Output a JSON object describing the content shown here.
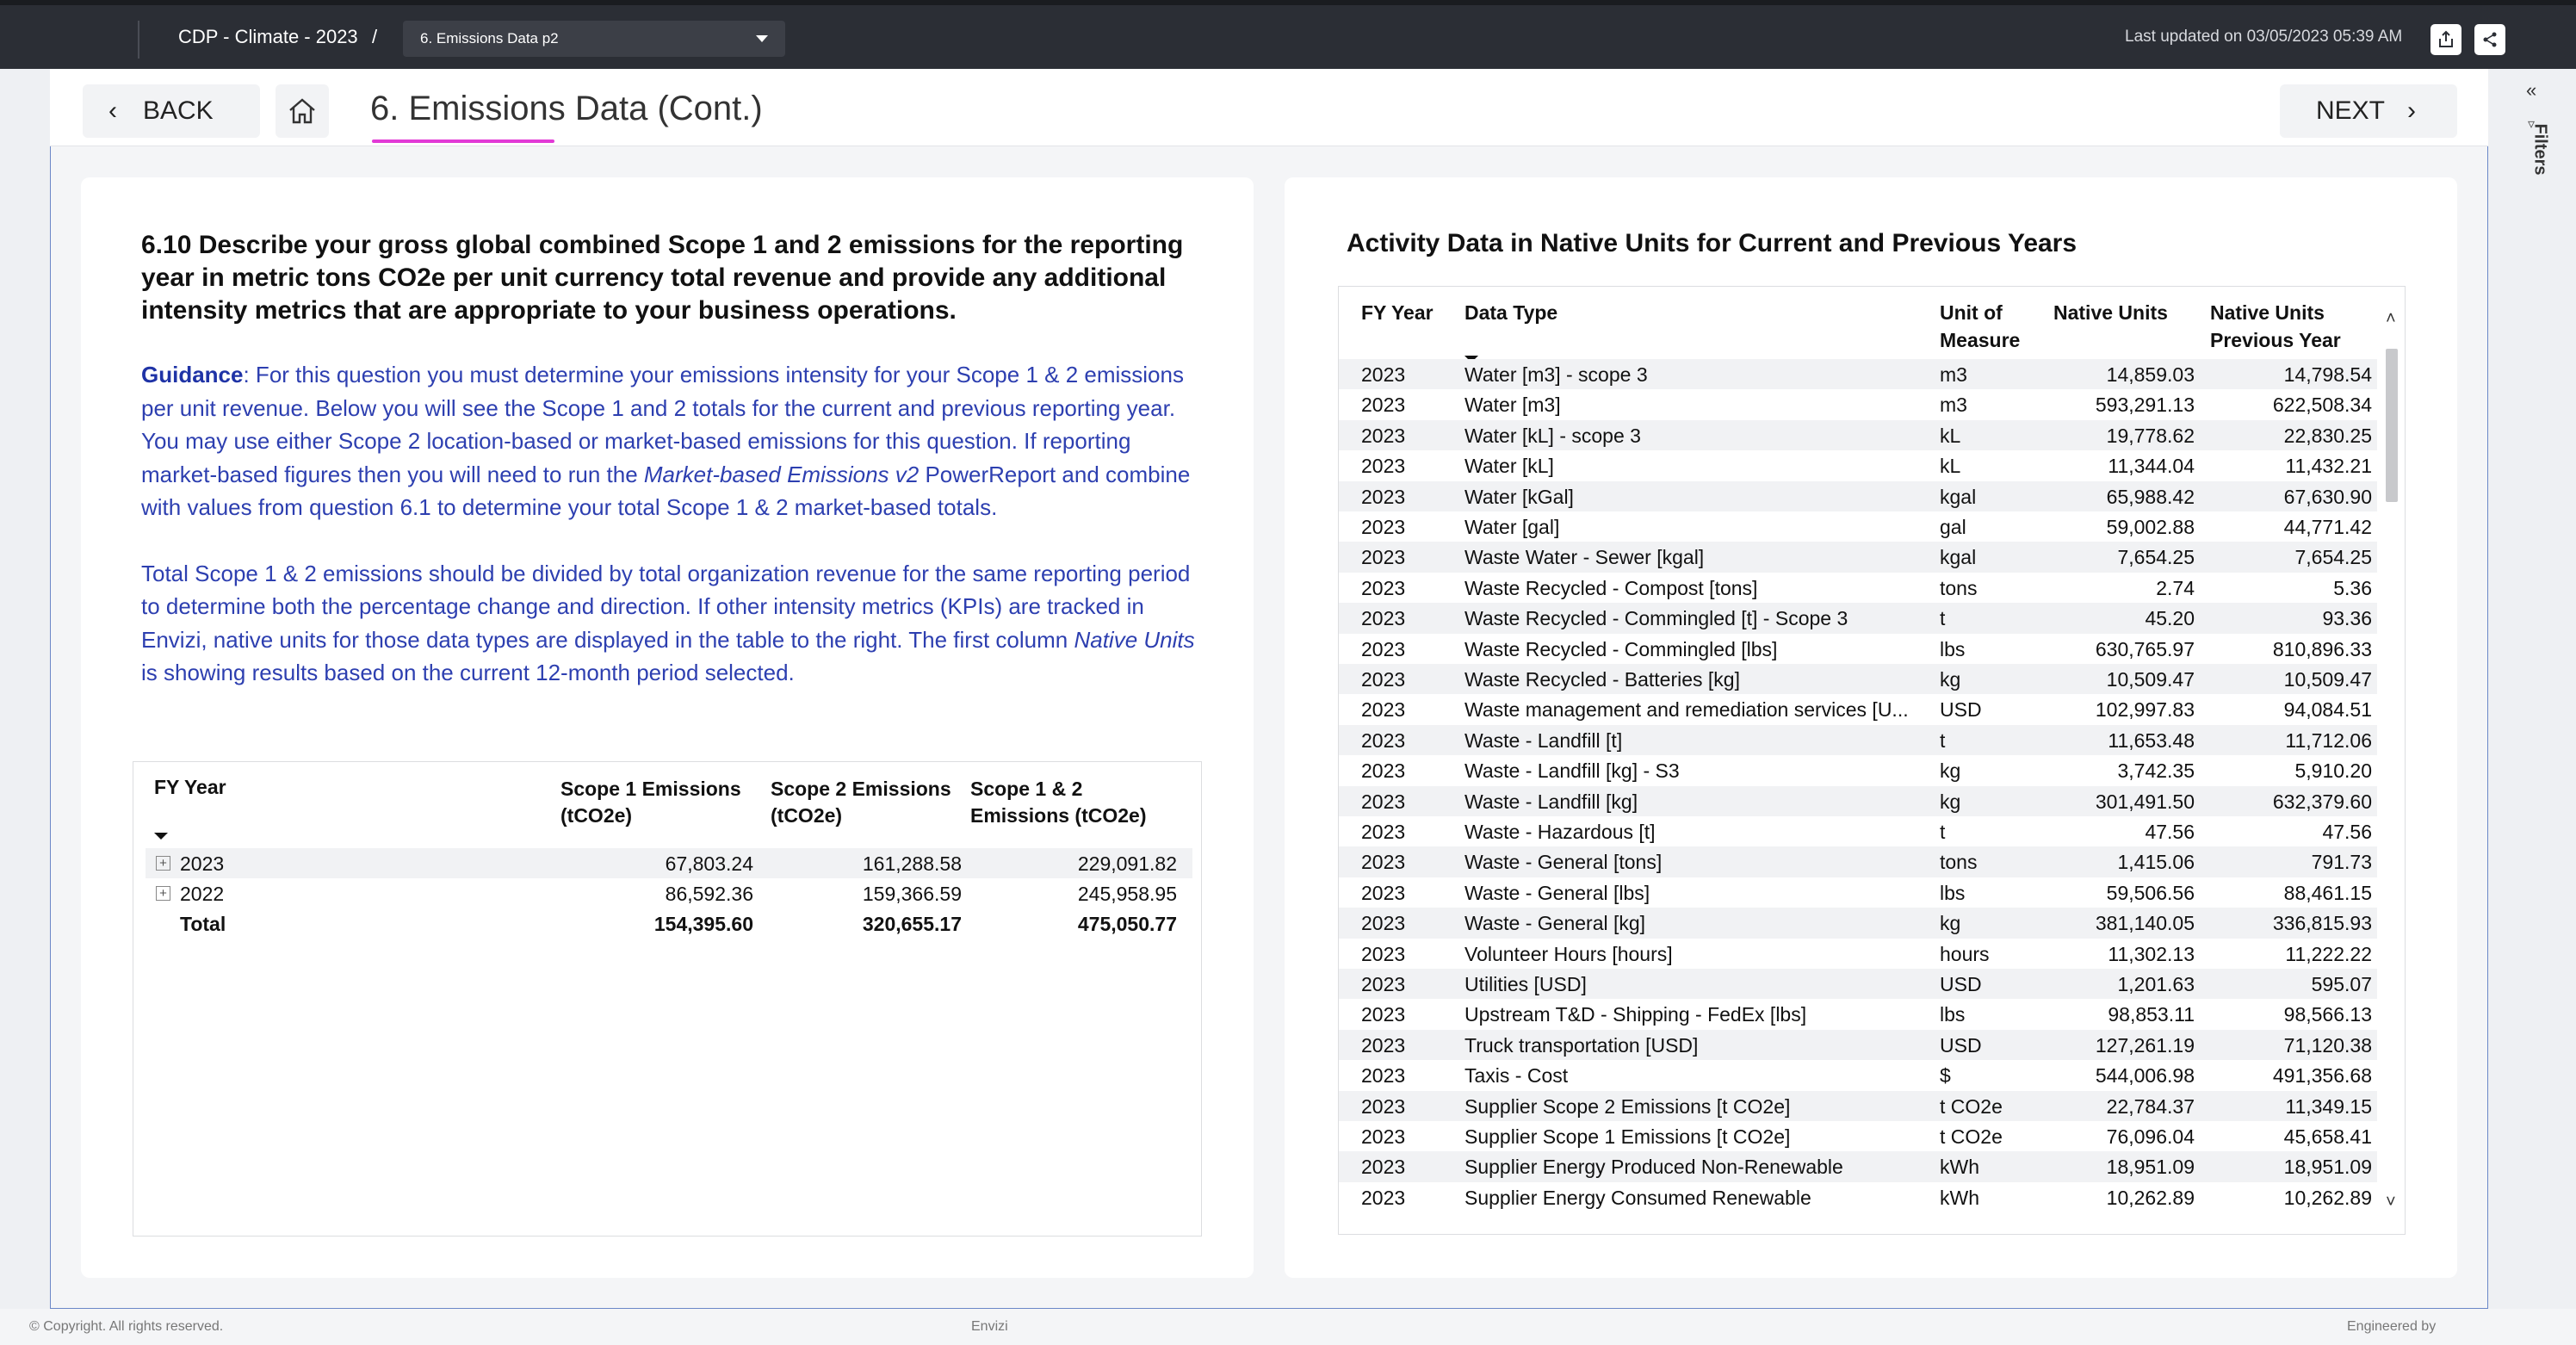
{
  "topbar": {
    "breadcrumb": "CDP - Climate - 2023",
    "separator": "/",
    "page_select": "6. Emissions Data p2",
    "last_updated": "Last updated on 03/05/2023 05:39 AM"
  },
  "filters_label": "Filters",
  "nav": {
    "back_label": "BACK",
    "next_label": "NEXT",
    "page_title": "6. Emissions Data (Cont.)"
  },
  "left": {
    "question": "6.10 Describe your gross global combined Scope 1 and 2 emissions for the reporting year in metric tons CO2e per unit currency total revenue and provide any additional intensity metrics that are appropriate to your business operations.",
    "guidance_label": "Guidance",
    "guidance_p1a": ": For this question you must determine your emissions intensity for your Scope 1 & 2 emissions per unit revenue. Below you will see the Scope 1 and 2 totals for the current and previous reporting year. You may use either Scope 2 location-based or market-based emissions for this question. If reporting market-based figures then you will need to run the ",
    "guidance_p1_em": "Market-based Emissions v2",
    "guidance_p1b": " PowerReport and combine with values from question 6.1 to determine your total Scope 1 & 2 market-based totals.",
    "guidance_p2a": "Total Scope 1 & 2 emissions should be divided by total organization revenue for the same reporting period to determine both the percentage change and direction. If other intensity metrics (KPIs) are tracked in Envizi, native units for those data types are displayed in the table to the right. The first column ",
    "guidance_p2_em": "Native Units",
    "guidance_p2b": " is showing results based on the current 12-month period selected.",
    "table": {
      "headers": {
        "year": "FY Year",
        "s1": "Scope 1 Emissions (tCO2e)",
        "s2": "Scope 2 Emissions (tCO2e)",
        "s12": "Scope 1 & 2 Emissions (tCO2e)"
      },
      "rows": [
        {
          "year": "2023",
          "s1": "67,803.24",
          "s2": "161,288.58",
          "s12": "229,091.82"
        },
        {
          "year": "2022",
          "s1": "86,592.36",
          "s2": "159,366.59",
          "s12": "245,958.95"
        }
      ],
      "total": {
        "year": "Total",
        "s1": "154,395.60",
        "s2": "320,655.17",
        "s12": "475,050.77"
      }
    }
  },
  "right": {
    "title": "Activity Data in Native Units for Current and Previous Years",
    "headers": {
      "year": "FY Year",
      "type": "Data Type",
      "unit": "Unit of Measure",
      "native": "Native Units",
      "prev": "Native Units Previous Year"
    },
    "rows": [
      {
        "year": "2023",
        "type": "Water [m3] - scope 3",
        "unit": "m3",
        "native": "14,859.03",
        "prev": "14,798.54"
      },
      {
        "year": "2023",
        "type": "Water [m3]",
        "unit": "m3",
        "native": "593,291.13",
        "prev": "622,508.34"
      },
      {
        "year": "2023",
        "type": "Water [kL] - scope 3",
        "unit": "kL",
        "native": "19,778.62",
        "prev": "22,830.25"
      },
      {
        "year": "2023",
        "type": "Water [kL]",
        "unit": "kL",
        "native": "11,344.04",
        "prev": "11,432.21"
      },
      {
        "year": "2023",
        "type": "Water [kGal]",
        "unit": "kgal",
        "native": "65,988.42",
        "prev": "67,630.90"
      },
      {
        "year": "2023",
        "type": "Water [gal]",
        "unit": "gal",
        "native": "59,002.88",
        "prev": "44,771.42"
      },
      {
        "year": "2023",
        "type": "Waste Water - Sewer [kgal]",
        "unit": "kgal",
        "native": "7,654.25",
        "prev": "7,654.25"
      },
      {
        "year": "2023",
        "type": "Waste Recycled - Compost [tons]",
        "unit": "tons",
        "native": "2.74",
        "prev": "5.36"
      },
      {
        "year": "2023",
        "type": "Waste Recycled - Commingled [t] - Scope 3",
        "unit": "t",
        "native": "45.20",
        "prev": "93.36"
      },
      {
        "year": "2023",
        "type": "Waste Recycled - Commingled [lbs]",
        "unit": "lbs",
        "native": "630,765.97",
        "prev": "810,896.33"
      },
      {
        "year": "2023",
        "type": "Waste Recycled - Batteries [kg]",
        "unit": "kg",
        "native": "10,509.47",
        "prev": "10,509.47"
      },
      {
        "year": "2023",
        "type": "Waste management and remediation services [U...",
        "unit": "USD",
        "native": "102,997.83",
        "prev": "94,084.51"
      },
      {
        "year": "2023",
        "type": "Waste - Landfill [t]",
        "unit": "t",
        "native": "11,653.48",
        "prev": "11,712.06"
      },
      {
        "year": "2023",
        "type": "Waste - Landfill [kg] - S3",
        "unit": "kg",
        "native": "3,742.35",
        "prev": "5,910.20"
      },
      {
        "year": "2023",
        "type": "Waste - Landfill [kg]",
        "unit": "kg",
        "native": "301,491.50",
        "prev": "632,379.60"
      },
      {
        "year": "2023",
        "type": "Waste - Hazardous [t]",
        "unit": "t",
        "native": "47.56",
        "prev": "47.56"
      },
      {
        "year": "2023",
        "type": "Waste - General [tons]",
        "unit": "tons",
        "native": "1,415.06",
        "prev": "791.73"
      },
      {
        "year": "2023",
        "type": "Waste - General [lbs]",
        "unit": "lbs",
        "native": "59,506.56",
        "prev": "88,461.15"
      },
      {
        "year": "2023",
        "type": "Waste - General [kg]",
        "unit": "kg",
        "native": "381,140.05",
        "prev": "336,815.93"
      },
      {
        "year": "2023",
        "type": "Volunteer Hours [hours]",
        "unit": "hours",
        "native": "11,302.13",
        "prev": "11,222.22"
      },
      {
        "year": "2023",
        "type": "Utilities [USD]",
        "unit": "USD",
        "native": "1,201.63",
        "prev": "595.07"
      },
      {
        "year": "2023",
        "type": "Upstream T&D - Shipping - FedEx [lbs]",
        "unit": "lbs",
        "native": "98,853.11",
        "prev": "98,566.13"
      },
      {
        "year": "2023",
        "type": "Truck transportation [USD]",
        "unit": "USD",
        "native": "127,261.19",
        "prev": "71,120.38"
      },
      {
        "year": "2023",
        "type": "Taxis - Cost",
        "unit": "$",
        "native": "544,006.98",
        "prev": "491,356.68"
      },
      {
        "year": "2023",
        "type": "Supplier Scope 2 Emissions [t CO2e]",
        "unit": "t CO2e",
        "native": "22,784.37",
        "prev": "11,349.15"
      },
      {
        "year": "2023",
        "type": "Supplier Scope 1 Emissions [t CO2e]",
        "unit": "t CO2e",
        "native": "76,096.04",
        "prev": "45,658.41"
      },
      {
        "year": "2023",
        "type": "Supplier Energy Produced Non-Renewable",
        "unit": "kWh",
        "native": "18,951.09",
        "prev": "18,951.09"
      },
      {
        "year": "2023",
        "type": "Supplier Energy Consumed Renewable",
        "unit": "kWh",
        "native": "10,262.89",
        "prev": "10,262.89"
      }
    ]
  },
  "footer": {
    "copyright": "© Copyright. All rights reserved.",
    "brand": "Envizi",
    "engineered": "Engineered by"
  }
}
